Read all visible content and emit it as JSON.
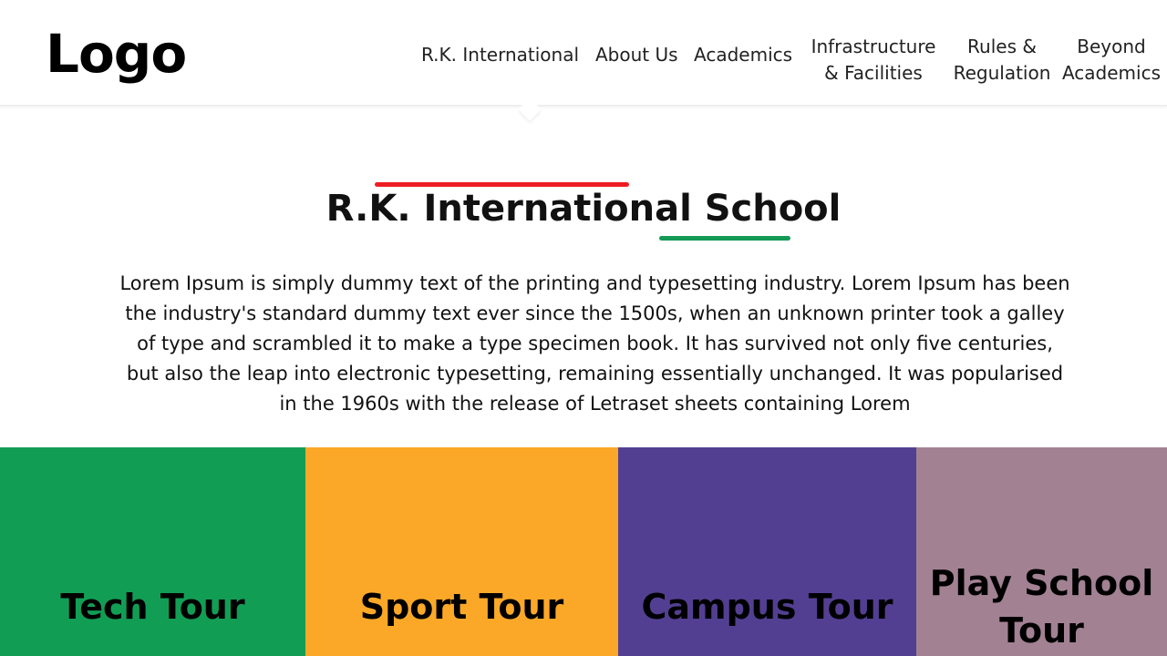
{
  "header": {
    "logo_text": "Logo",
    "nav": [
      {
        "label": "R.K. International",
        "active": true
      },
      {
        "label": "About Us"
      },
      {
        "label": "Academics"
      },
      {
        "line1": "Infrastructure",
        "line2": "& Facilities"
      },
      {
        "line1": "Rules &",
        "line2": "Regulation"
      },
      {
        "line1": "Beyond",
        "line2": "Academics"
      }
    ]
  },
  "intro": {
    "title": "R.K. International School",
    "body": "Lorem Ipsum is simply dummy text of the printing and typesetting industry. Lorem Ipsum has been the industry's standard dummy text ever since the 1500s, when an unknown printer took a galley of type and scrambled it to make a type specimen book. It has survived not only five centuries, but also the leap into electronic typesetting, remaining essentially unchanged. It was popularised in the 1960s with the release of Letraset sheets containing Lorem"
  },
  "tours": [
    {
      "label": "Tech Tour",
      "color": "#129d55"
    },
    {
      "label": "Sport Tour",
      "color": "#fba828"
    },
    {
      "label": "Campus Tour",
      "color": "#533f92"
    },
    {
      "line1": "Play School",
      "line2": "Tour",
      "color": "#a28193"
    }
  ],
  "colors": {
    "accent_red": "#ee1c24",
    "accent_green": "#149a56"
  }
}
